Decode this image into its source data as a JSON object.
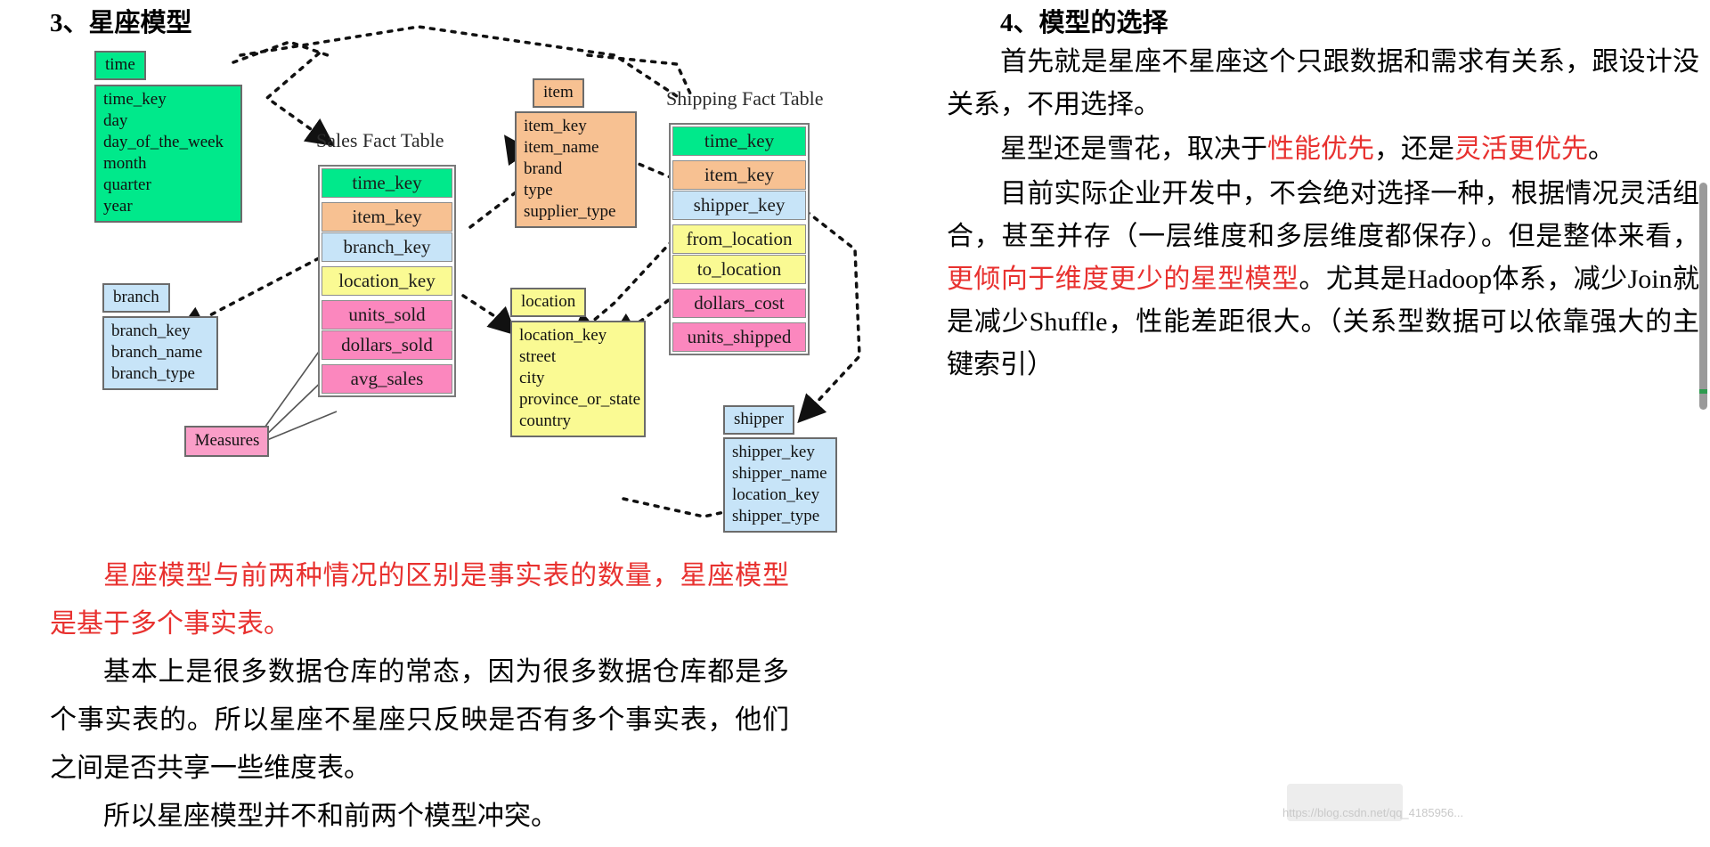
{
  "headings": {
    "left": "3、星座模型",
    "right": "4、模型的选择"
  },
  "diagram": {
    "fact_tables": [
      {
        "title": "Sales Fact Table",
        "rows": [
          "time_key",
          "item_key",
          "branch_key",
          "location_key",
          "units_sold",
          "dollars_sold",
          "avg_sales"
        ]
      },
      {
        "title": "Shipping Fact Table",
        "rows": [
          "time_key",
          "item_key",
          "shipper_key",
          "from_location",
          "to_location",
          "dollars_cost",
          "units_shipped"
        ]
      }
    ],
    "dimensions": {
      "time": {
        "title": "time",
        "fields": [
          "time_key",
          "day",
          "day_of_the_week",
          "month",
          "quarter",
          "year"
        ]
      },
      "branch": {
        "title": "branch",
        "fields": [
          "branch_key",
          "branch_name",
          "branch_type"
        ]
      },
      "item": {
        "title": "item",
        "fields": [
          "item_key",
          "item_name",
          "brand",
          "type",
          "supplier_type"
        ]
      },
      "location": {
        "title": "location",
        "fields": [
          "location_key",
          "street",
          "city",
          "province_or_state",
          "country"
        ]
      },
      "shipper": {
        "title": "shipper",
        "fields": [
          "shipper_key",
          "shipper_name",
          "location_key",
          "shipper_type"
        ]
      }
    },
    "measures_label": "Measures",
    "colors": {
      "time_green": "#00E98B",
      "item_orange": "#F7C192",
      "branch_blue": "#C7E4F8",
      "location_yellow": "#FAFA93",
      "measure_pink": "#FB87BE",
      "measures_box_pink": "#FA9EC8",
      "border_gray": "#6B6B6B",
      "highlight_red": "#E8312F"
    }
  },
  "left_text": {
    "p1_red": "星座模型与前两种情况的区别是事实表的数量，星座模型是基于多个事实表。",
    "p2": "基本上是很多数据仓库的常态，因为很多数据仓库都是多个事实表的。所以星座不星座只反映是否有多个事实表，他们之间是否共享一些维度表。",
    "p3": "所以星座模型并不和前两个模型冲突。"
  },
  "right_text": {
    "p1": "首先就是星座不星座这个只跟数据和需求有关系，跟设计没关系，不用选择。",
    "p2_a": "星型还是雪花，取决于",
    "p2_red1": "性能优先",
    "p2_b": "，还是",
    "p2_red2": "灵活更优先",
    "p2_c": "。",
    "p3_a": "目前实际企业开发中，不会绝对选择一种，根据情况灵活组合，甚至并存（一层维度和多层维度都保存）。但是整体来看，",
    "p3_red": "更倾向于维度更少的星型模型",
    "p3_b": "。尤其是Hadoop体系，减少Join就是减少Shuffle，性能差距很大。（关系型数据可以依靠强大的主键索引）"
  },
  "watermark": "https://blog.csdn.net/qq_4185956..."
}
